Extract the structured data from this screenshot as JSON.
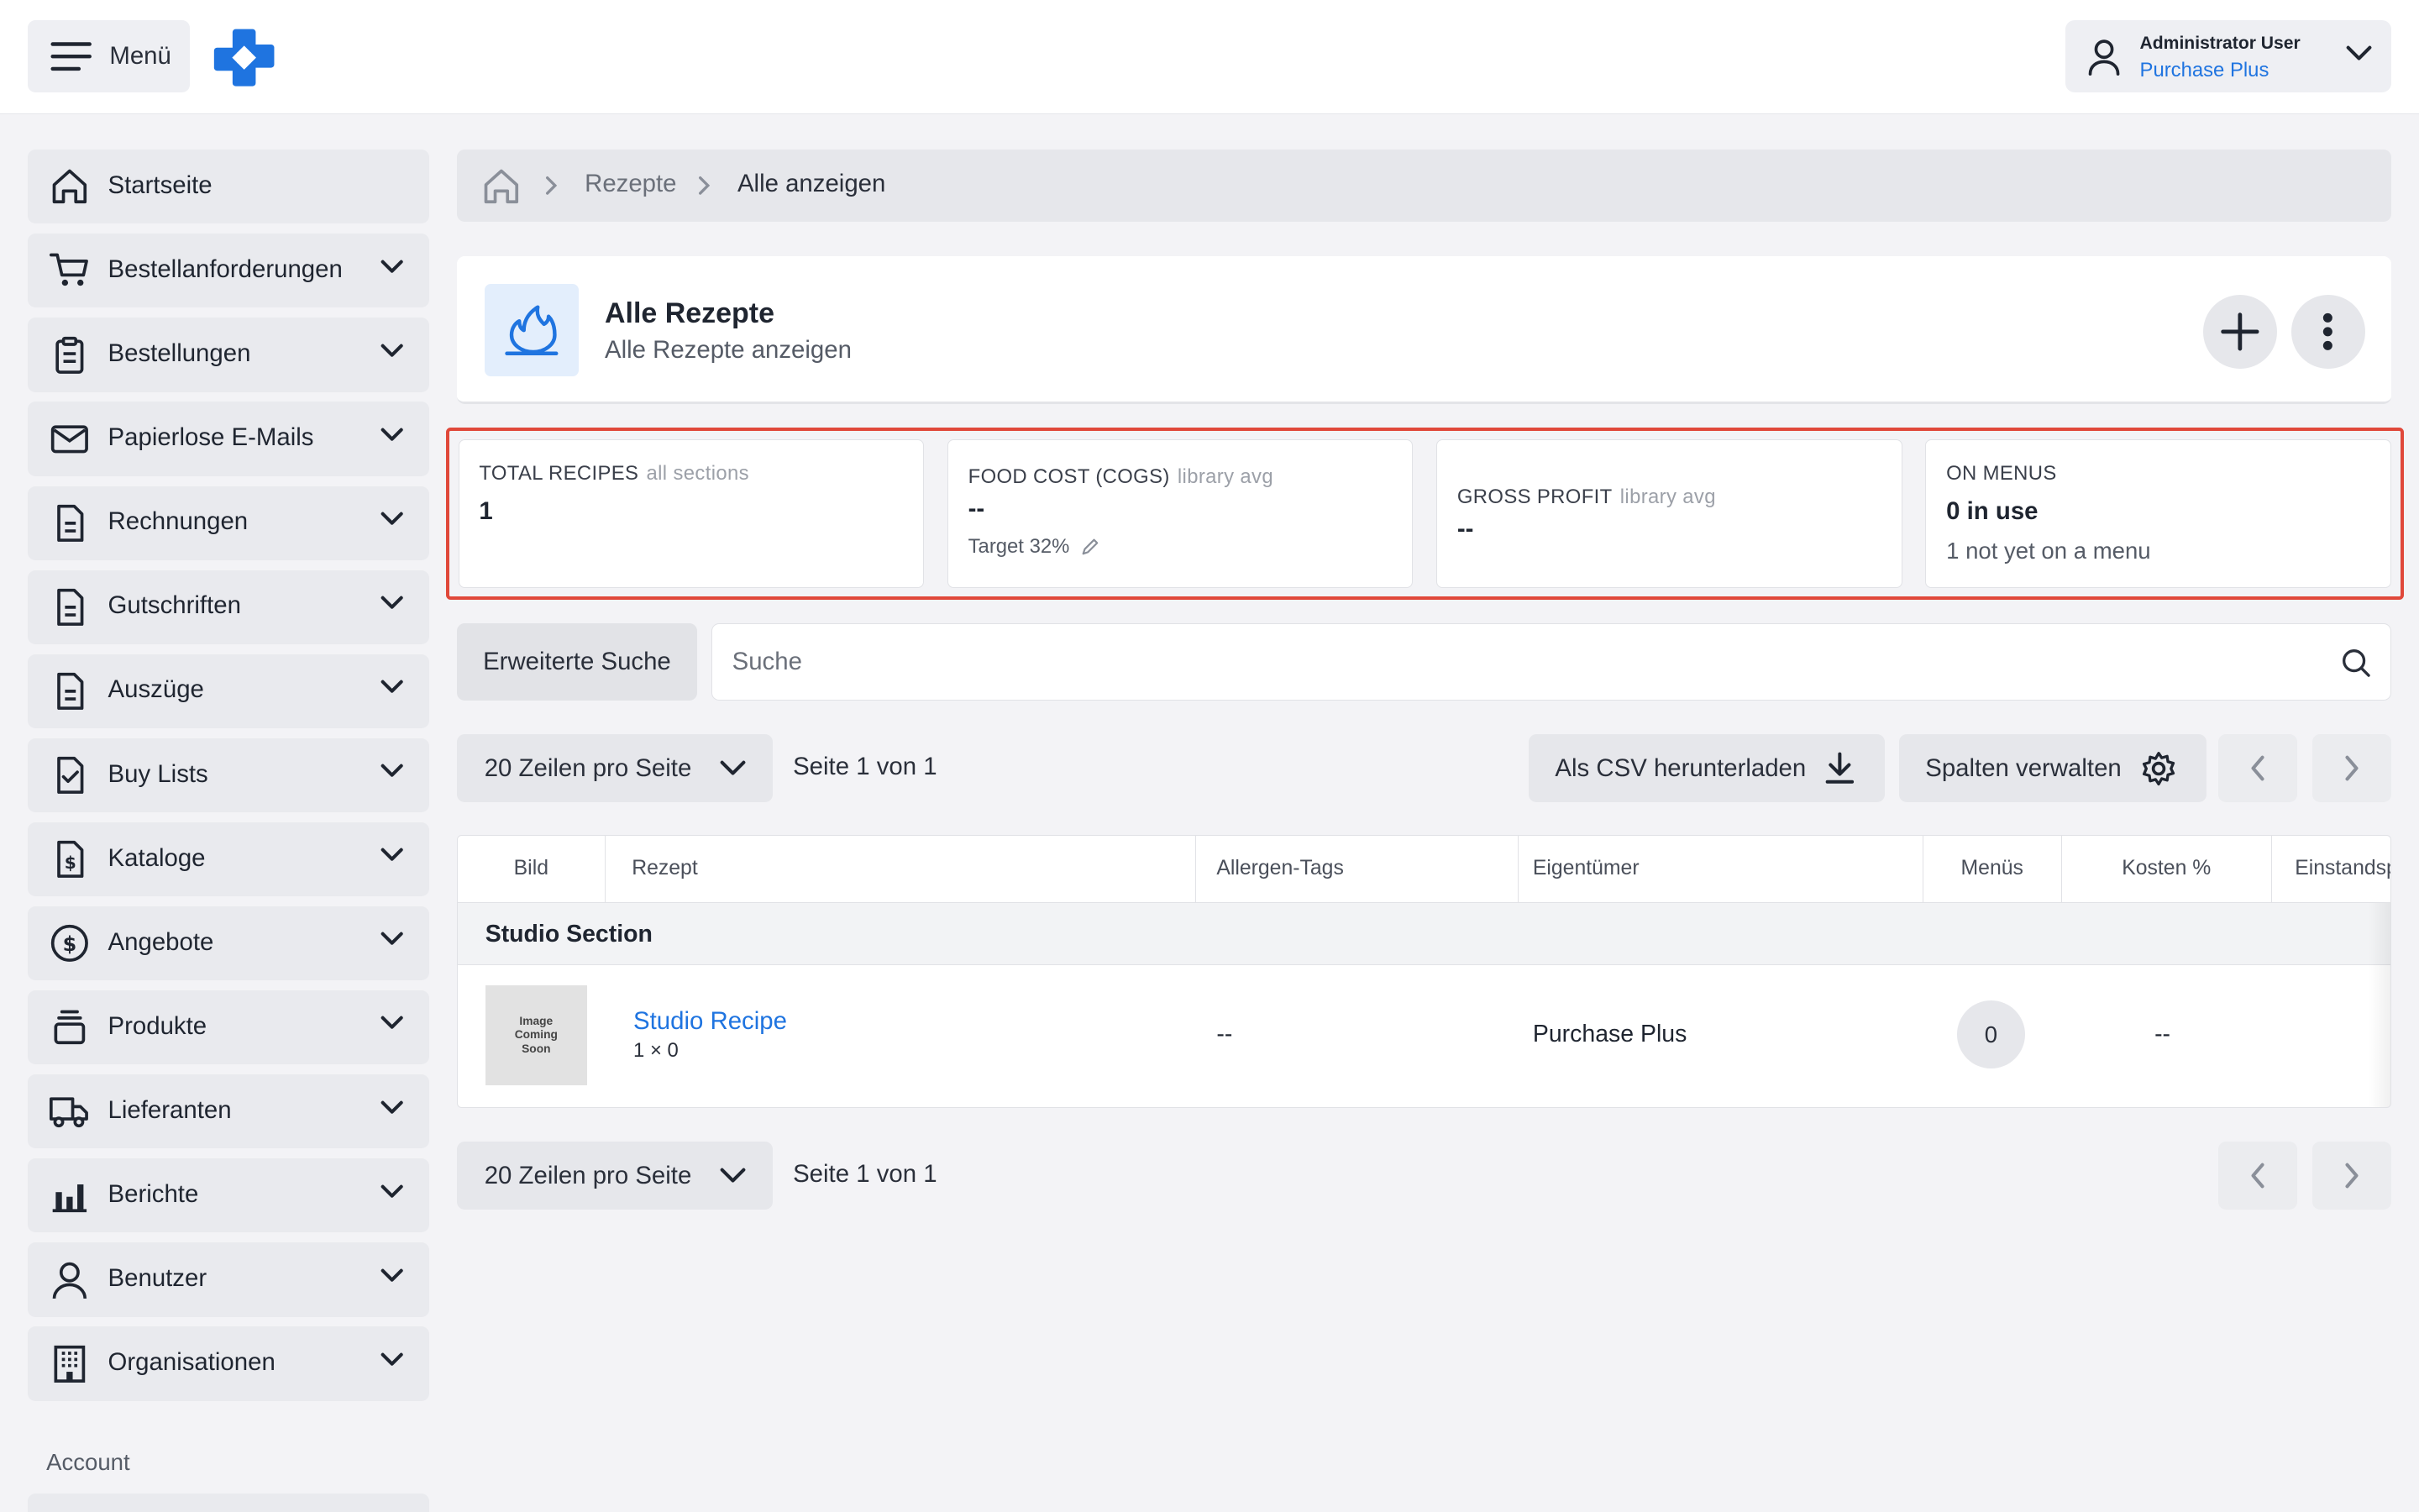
{
  "header": {
    "menu_label": "Menü",
    "user_name": "Administrator User",
    "user_org": "Purchase Plus",
    "brand_color": "#1f74e0"
  },
  "sidebar": {
    "items": [
      {
        "label": "Startseite",
        "icon": "home-icon"
      },
      {
        "label": "Bestellanforderungen",
        "icon": "cart-icon"
      },
      {
        "label": "Bestellungen",
        "icon": "clipboard-icon"
      },
      {
        "label": "Papierlose E-Mails",
        "icon": "mail-icon"
      },
      {
        "label": "Rechnungen",
        "icon": "document-icon"
      },
      {
        "label": "Gutschriften",
        "icon": "document-icon"
      },
      {
        "label": "Auszüge",
        "icon": "document-icon"
      },
      {
        "label": "Buy Lists",
        "icon": "checklist-icon"
      },
      {
        "label": "Kataloge",
        "icon": "dollar-doc-icon"
      },
      {
        "label": "Angebote",
        "icon": "dollar-circle-icon"
      },
      {
        "label": "Produkte",
        "icon": "stack-icon"
      },
      {
        "label": "Lieferanten",
        "icon": "truck-icon"
      },
      {
        "label": "Berichte",
        "icon": "bar-chart-icon"
      },
      {
        "label": "Benutzer",
        "icon": "user-icon"
      },
      {
        "label": "Organisationen",
        "icon": "building-icon"
      }
    ],
    "section_label": "Account"
  },
  "breadcrumb": {
    "items": [
      "Rezepte",
      "Alle anzeigen"
    ]
  },
  "title_card": {
    "title": "Alle Rezepte",
    "subtitle": "Alle Rezepte anzeigen",
    "icon": "flame-icon"
  },
  "stats": {
    "total_recipes": {
      "label": "TOTAL RECIPES",
      "hint": "all sections",
      "value": "1"
    },
    "food_cost": {
      "label": "FOOD COST (COGS)",
      "hint": "library avg",
      "value": "--",
      "target": "Target 32%"
    },
    "gross_profit": {
      "label": "GROSS PROFIT",
      "hint": "library avg",
      "value": "--"
    },
    "on_menus": {
      "label": "ON MENUS",
      "value": "0 in use",
      "note": "1 not yet on a menu"
    },
    "highlight_color": "#e0483a"
  },
  "search": {
    "advanced_label": "Erweiterte Suche",
    "placeholder": "Suche"
  },
  "pagination": {
    "rows_per_page": "20 Zeilen pro Seite",
    "page_info": "Seite 1 von 1"
  },
  "toolbar": {
    "csv_label": "Als CSV herunterladen",
    "columns_label": "Spalten verwalten"
  },
  "table": {
    "columns": [
      "Bild",
      "Rezept",
      "Allergen-Tags",
      "Eigentümer",
      "Menüs",
      "Kosten %",
      "Einstandspreis"
    ],
    "groups": [
      {
        "name": "Studio Section",
        "rows": [
          {
            "image_text": "Image Coming Soon",
            "recipe": "Studio Recipe",
            "recipe_sub": "1 × 0",
            "allergen_tags": "--",
            "owner": "Purchase Plus",
            "menus": "0",
            "cost_pct": "--"
          }
        ]
      }
    ]
  }
}
